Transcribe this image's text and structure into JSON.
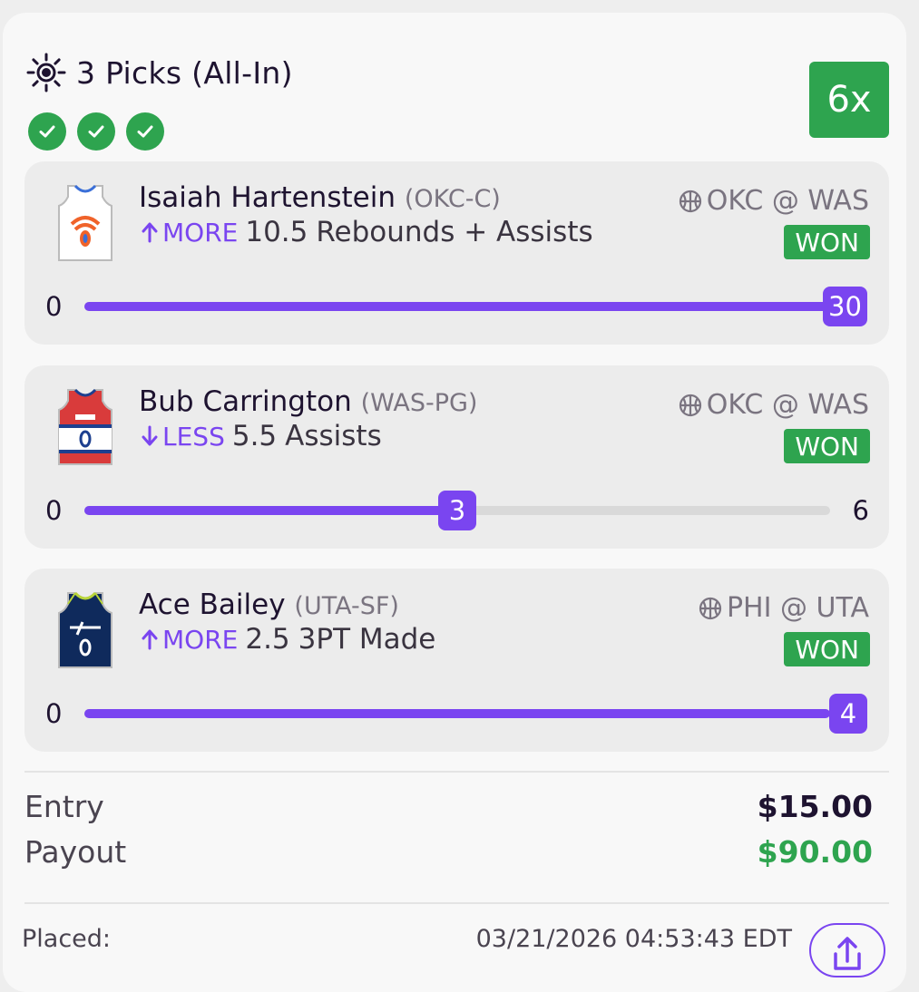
{
  "header": {
    "title": "3 Picks (All-In)",
    "icon": "sun-icon",
    "multiplier": "6x",
    "results": [
      "won",
      "won",
      "won"
    ]
  },
  "picks": [
    {
      "player": "Isaiah Hartenstein",
      "team_pos": "(OKC-C)",
      "direction": "MORE",
      "line": "10.5",
      "stat": "Rebounds + Assists",
      "matchup": "OKC @ WAS",
      "status": "WON",
      "range_min": "0",
      "result": "30",
      "progress_fraction": 1.0,
      "jersey_colors": {
        "body": "#ffffff",
        "trim": "#3a6fd8",
        "logo": "#f0632a"
      }
    },
    {
      "player": "Bub Carrington",
      "team_pos": "(WAS-PG)",
      "direction": "LESS",
      "line": "5.5",
      "stat": "Assists",
      "matchup": "OKC @ WAS",
      "status": "WON",
      "range_min": "0",
      "range_max": "6",
      "result": "3",
      "progress_fraction": 0.5,
      "jersey_colors": {
        "body": "#d93b3b",
        "trim": "#1d3f8f",
        "logo": "#ffffff"
      }
    },
    {
      "player": "Ace Bailey",
      "team_pos": "(UTA-SF)",
      "direction": "MORE",
      "line": "2.5",
      "stat": "3PT Made",
      "matchup": "PHI @ UTA",
      "status": "WON",
      "range_min": "0",
      "result": "4",
      "progress_fraction": 1.0,
      "jersey_colors": {
        "body": "#0f2a5c",
        "trim": "#b8d43a",
        "logo": "#ffffff"
      }
    }
  ],
  "summary": {
    "entry_label": "Entry",
    "entry_value": "$15.00",
    "payout_label": "Payout",
    "payout_value": "$90.00",
    "placed_label": "Placed:",
    "placed_value": "03/21/2026 04:53:43 EDT"
  },
  "colors": {
    "accent": "#7a45f0",
    "win": "#2ea44f",
    "text": "#1e1330",
    "muted": "#7a7480"
  }
}
